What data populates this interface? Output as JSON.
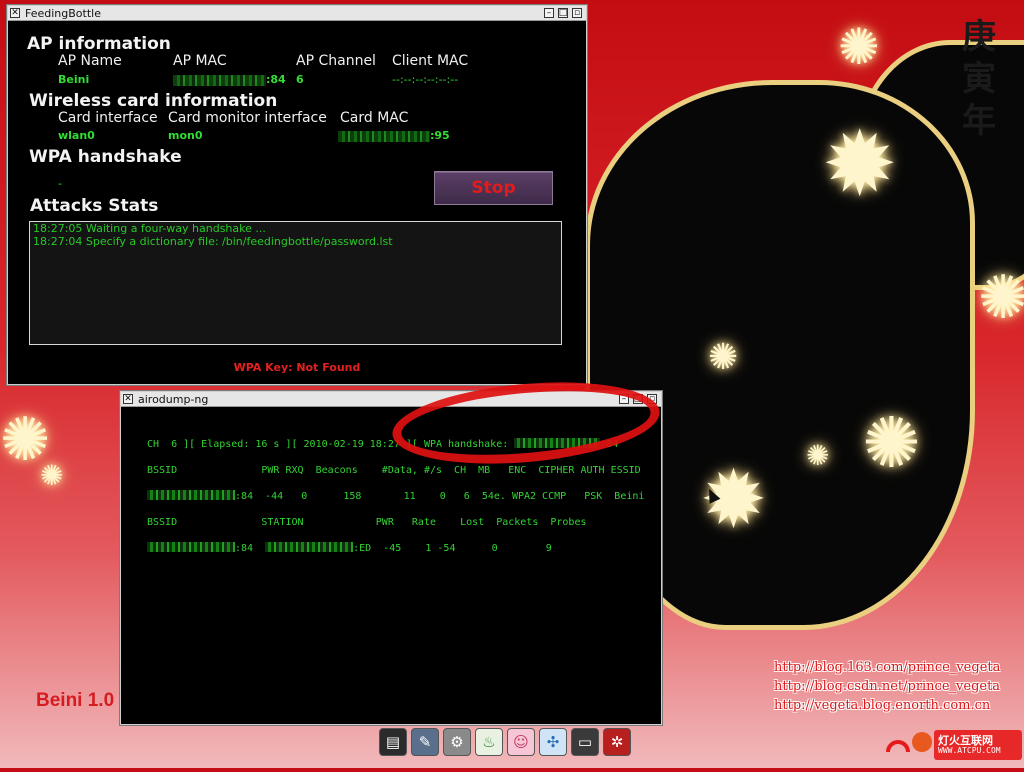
{
  "desktop": {
    "year_chars": [
      "庚",
      "寅",
      "年"
    ],
    "links": [
      "http://blog.163.com/prince_vegeta",
      "http://blog.csdn.net/prince_vegeta",
      "http://vegeta.blog.enorth.com.cn"
    ],
    "brand": "Beini 1.0",
    "logo_text": "灯火互联网",
    "logo_url": "WWW.ATCPU.COM"
  },
  "feeding_bottle": {
    "title": "FeedingBottle",
    "ap_section": "AP information",
    "ap_headers": [
      "AP Name",
      "AP MAC",
      "AP Channel",
      "Client MAC"
    ],
    "ap_values": {
      "name": "Beini",
      "mac_suffix": ":84",
      "channel": "6",
      "client_mac": "--:--:--:--:--:--"
    },
    "card_section": "Wireless card information",
    "card_headers": [
      "Card interface",
      "Card monitor interface",
      "Card MAC"
    ],
    "card_values": {
      "interface": "wlan0",
      "monitor": "mon0",
      "mac_suffix": ":95"
    },
    "wpa_section": "WPA handshake",
    "wpa_value": "-",
    "stop_label": "Stop",
    "attacks_section": "Attacks Stats",
    "log": [
      "18:27:05 Waiting a four-way handshake ...",
      "18:27:04 Specify a dictionary file: /bin/feedingbottle/password.lst"
    ],
    "wpa_key": "WPA Key: Not Found"
  },
  "airodump": {
    "title": "airodump-ng",
    "status_line": {
      "prefix": "CH  6 ][ Elapsed: 16 s ][ 2010-02-19 18:27 ][ WPA handshake: ",
      "suffix": ":84"
    },
    "ap_header": "BSSID              PWR RXQ  Beacons    #Data, #/s  CH  MB   ENC  CIPHER AUTH ESSID",
    "ap_row": {
      "suffix": ":84",
      "rest": "  -44   0      158       11    0   6  54e. WPA2 CCMP   PSK  Beini"
    },
    "sta_header": "BSSID              STATION            PWR   Rate    Lost  Packets  Probes",
    "sta_row": {
      "bssid_suffix": ":84",
      "station_suffix": ":ED",
      "rest": "  -45    1 -54      0        9"
    }
  },
  "dock": {
    "icons": [
      "terminal-icon",
      "tools-icon",
      "gears-icon",
      "feedingbottle-icon",
      "baby-icon",
      "network-icon",
      "console-icon",
      "settings-icon"
    ]
  }
}
